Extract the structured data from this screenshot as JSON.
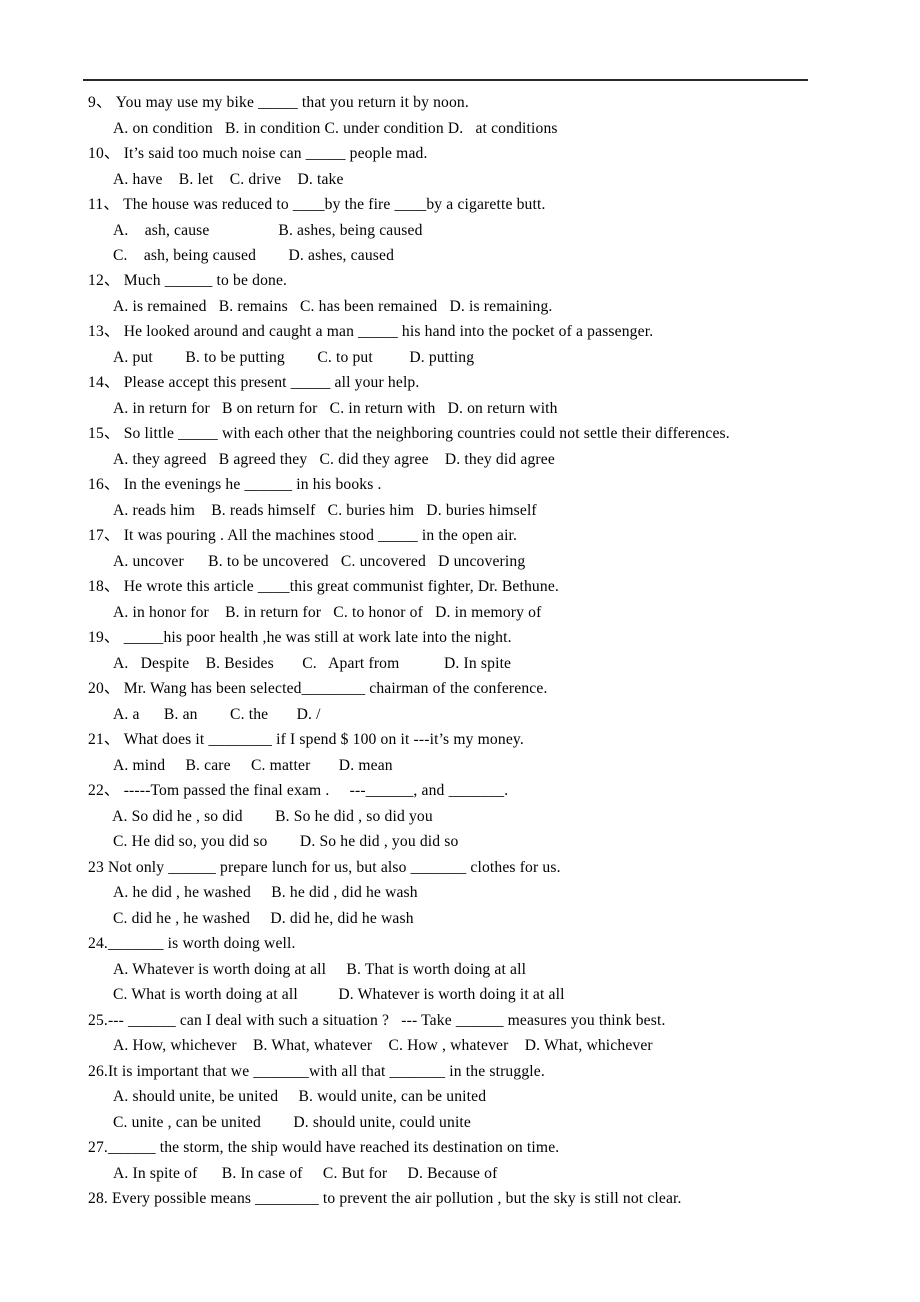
{
  "document": {
    "type": "english-grammar-multiple-choice-worksheet",
    "header_rule": true,
    "items": [
      {
        "number": "9、",
        "stem": "9、 You may use my bike _____ that you return it by noon.",
        "option_lines": [
          "A. on condition   B. in condition C. under condition D.   at conditions"
        ]
      },
      {
        "number": "10、",
        "stem": "10、 It’s said too much noise can _____ people mad.",
        "option_lines": [
          "A. have    B. let    C. drive    D. take"
        ]
      },
      {
        "number": "11、",
        "stem": "11、 The house was reduced to ____by the fire ____by a cigarette butt.",
        "option_lines": [
          "A.    ash, cause                 B. ashes, being caused",
          "C.    ash, being caused        D. ashes, caused"
        ]
      },
      {
        "number": "12、",
        "stem": "12、 Much ______ to be done.",
        "option_lines": [
          "A. is remained   B. remains   C. has been remained   D. is remaining."
        ]
      },
      {
        "number": "13、",
        "stem": "13、 He looked around and caught a man _____ his hand into the pocket of a passenger.",
        "option_lines": [
          "A. put        B. to be putting        C. to put         D. putting"
        ]
      },
      {
        "number": "14、",
        "stem": "14、 Please accept this present _____ all your help.",
        "option_lines": [
          "A. in return for   B on return for   C. in return with   D. on return with"
        ]
      },
      {
        "number": "15、",
        "stem": "15、 So little _____ with each other that the neighboring countries could not settle their differences.",
        "option_lines": [
          "A. they agreed   B agreed they   C. did they agree    D. they did agree"
        ]
      },
      {
        "number": "16、",
        "stem": "16、 In the evenings he ______ in his books .",
        "option_lines": [
          "A. reads him    B. reads himself   C. buries him   D. buries himself"
        ]
      },
      {
        "number": "17、",
        "stem": "17、 It was pouring . All the machines stood _____ in the open air.",
        "option_lines": [
          "A. uncover      B. to be uncovered   C. uncovered   D uncovering"
        ]
      },
      {
        "number": "18、",
        "stem": "18、 He wrote this article ____this great communist fighter, Dr. Bethune.",
        "option_lines": [
          "A. in honor for    B. in return for   C. to honor of   D. in memory of"
        ]
      },
      {
        "number": "19、",
        "stem": "19、 _____his poor health ,he was still at work late into the night.",
        "option_lines": [
          "A.   Despite    B. Besides       C.   Apart from           D. In spite"
        ]
      },
      {
        "number": "20、",
        "stem": "20、 Mr. Wang has been selected________ chairman of the conference.",
        "option_lines": [
          "A. a      B. an        C. the       D. /"
        ]
      },
      {
        "number": "21、",
        "stem": "21、 What does it ________ if I spend $ 100 on it ---it’s my money.",
        "option_lines": [
          "A. mind     B. care     C. matter       D. mean"
        ]
      },
      {
        "number": "22、",
        "stem": "22、 -----Tom passed the final exam .     ---______, and _______.",
        "option_lines": [
          " A. So did he , so did        B. So he did , so did you",
          "C. He did so, you did so        D. So he did , you did so"
        ]
      },
      {
        "number": "23",
        "stem": "23 Not only ______ prepare lunch for us, but also _______ clothes for us.",
        "option_lines": [
          "A. he did , he washed     B. he did , did he wash",
          "C. did he , he washed     D. did he, did he wash"
        ]
      },
      {
        "number": "24.",
        "stem": "24._______ is worth doing well.",
        "option_lines": [
          "A. Whatever is worth doing at all     B. That is worth doing at all",
          "C. What is worth doing at all          D. Whatever is worth doing it at all"
        ]
      },
      {
        "number": "25.",
        "stem": "25.--- ______ can I deal with such a situation ?   --- Take ______ measures you think best.",
        "option_lines": [
          "A. How, whichever    B. What, whatever    C. How , whatever    D. What, whichever"
        ]
      },
      {
        "number": "26.",
        "stem": "26.It is important that we _______with all that _______ in the struggle.",
        "option_lines": [
          "A. should unite, be united     B. would unite, can be united",
          "C. unite , can be united        D. should unite, could unite"
        ]
      },
      {
        "number": "27.",
        "stem": "27.______ the storm, the ship would have reached its destination on time.",
        "option_lines": [
          "A. In spite of      B. In case of     C. But for     D. Because of"
        ]
      },
      {
        "number": "28.",
        "stem": "28. Every possible means ________ to prevent the air pollution , but the sky is still not clear.",
        "option_lines": []
      }
    ]
  }
}
